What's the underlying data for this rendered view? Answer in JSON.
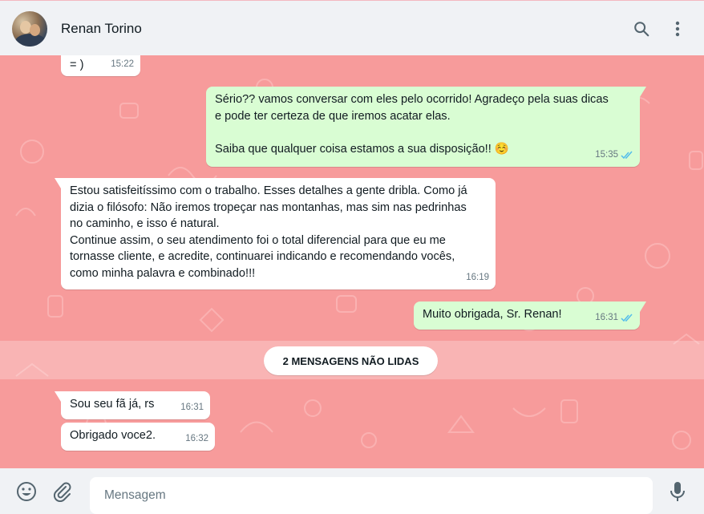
{
  "header": {
    "contact_name": "Renan Torino",
    "icons": [
      "search-icon",
      "menu-icon"
    ]
  },
  "messages": [
    {
      "dir": "in",
      "text": "= )",
      "time": "15:22"
    },
    {
      "dir": "out",
      "text": "Sério?? vamos conversar com eles pelo ocorrido! Agradeço pela suas dicas\ne pode ter certeza de que iremos acatar elas.\n\nSaiba que qualquer coisa estamos a sua disposição!! ☺️",
      "time": "15:35",
      "status": "read"
    },
    {
      "dir": "in",
      "text": "Estou satisfeitíssimo com o trabalho. Esses detalhes a gente dribla. Como já\ndizia o filósofo: Não iremos tropeçar nas montanhas, mas sim nas pedrinhas\nno caminho, e isso é natural.\nContinue assim, o seu atendimento foi o total diferencial para que eu me\ntornasse cliente, e acredite, continuarei indicando e recomendando vocês,\ncomo minha palavra e combinado!!!",
      "time": "16:19"
    },
    {
      "dir": "out",
      "text": "Muito obrigada, Sr. Renan!",
      "time": "16:31",
      "status": "read"
    },
    {
      "dir": "in",
      "text": "Sou seu fã já, rs",
      "time": "16:31"
    },
    {
      "dir": "in",
      "text": "Obrigado voce2.",
      "time": "16:32"
    }
  ],
  "unread_label": "2 MENSAGENS NÃO LIDAS",
  "footer": {
    "input_placeholder": "Mensagem",
    "icons": [
      "emoji-icon",
      "attach-icon",
      "mic-icon"
    ]
  },
  "colors": {
    "chat_background": "#f79b9b",
    "incoming_bubble": "#ffffff",
    "outgoing_bubble": "#d9fdd3",
    "read_ticks": "#53bdeb"
  }
}
